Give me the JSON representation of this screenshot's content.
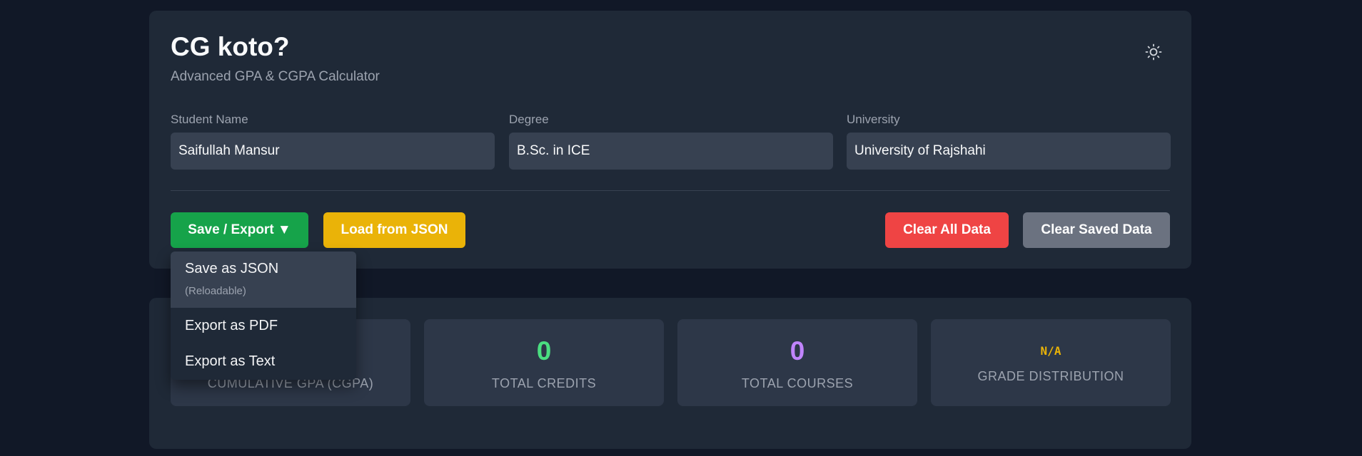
{
  "header": {
    "title": "CG koto?",
    "subtitle": "Advanced GPA & CGPA Calculator"
  },
  "fields": {
    "student_name": {
      "label": "Student Name",
      "value": "Saifullah Mansur"
    },
    "degree": {
      "label": "Degree",
      "value": "B.Sc. in ICE"
    },
    "university": {
      "label": "University",
      "value": "University of Rajshahi"
    }
  },
  "actions": {
    "save_export": "Save / Export ▼",
    "load_json": "Load from JSON",
    "clear_all": "Clear All Data",
    "clear_saved": "Clear Saved Data"
  },
  "dropdown": {
    "save_json": {
      "label": "Save as JSON",
      "hint": "(Reloadable)"
    },
    "export_pdf": {
      "label": "Export as PDF"
    },
    "export_text": {
      "label": "Export as Text"
    }
  },
  "stats": {
    "cgpa": {
      "label": "Cumulative GPA (CGPA)"
    },
    "credits": {
      "value": "0",
      "label": "Total Credits",
      "color": "#4ade80"
    },
    "courses": {
      "value": "0",
      "label": "Total Courses",
      "color": "#c084fc"
    },
    "grades": {
      "value": "N/A",
      "label": "Grade Distribution",
      "color": "#eab308"
    }
  },
  "icons": {
    "theme_toggle": "sun-icon"
  },
  "colors": {
    "background": "#111827",
    "panel": "#1f2937",
    "card": "#2d3748",
    "save": "#16a34a",
    "load": "#eab308",
    "clear_all": "#ef4444",
    "clear_saved": "#6b7280"
  }
}
